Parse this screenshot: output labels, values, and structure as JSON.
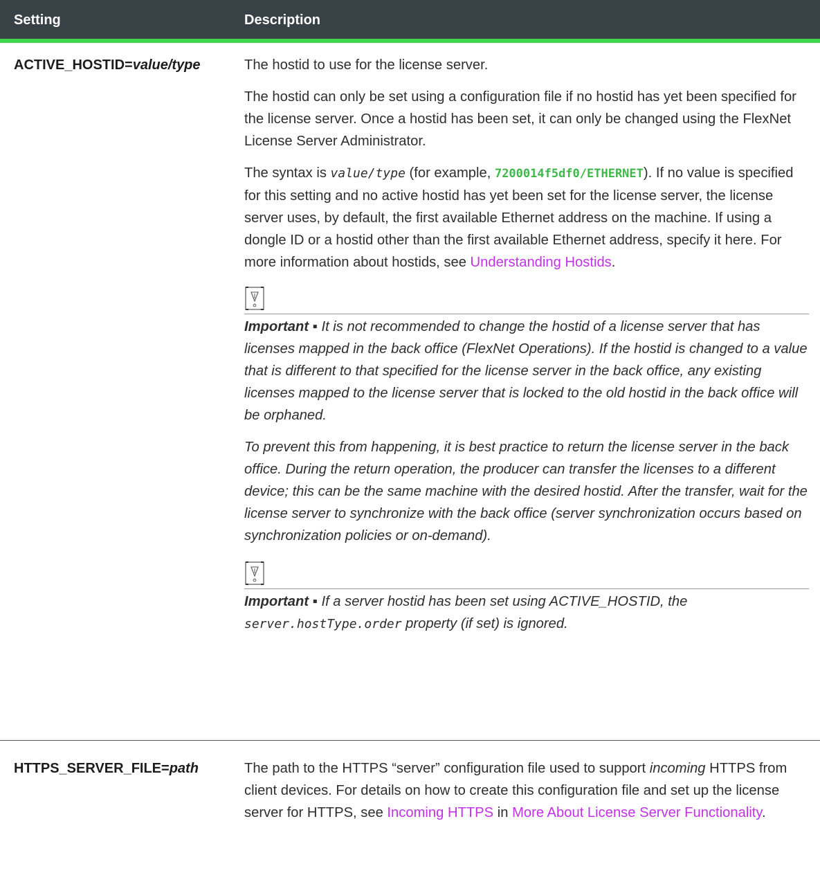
{
  "header": {
    "col_setting": "Setting",
    "col_description": "Description"
  },
  "row1": {
    "setting_name": "ACTIVE_HOSTID=",
    "setting_value": "value/type",
    "p1": "The hostid to use for the license server.",
    "p2": "The hostid can only be set using a configuration file if no hostid has yet been specified for the license server. Once a hostid has been set, it can only be changed using the FlexNet License Server Administrator.",
    "p3_a": "The syntax is ",
    "p3_code": "value/type",
    "p3_b": " (for example, ",
    "p3_example": "7200014f5df0/ETHERNET",
    "p3_c": "). If no value is specified for this setting and no active hostid has yet been set for the license server, the license server uses, by default, the first available Ethernet address on the machine. If using a dongle ID or a hostid other than the first available Ethernet address, specify it here. For more information about hostids, see ",
    "p3_link": "Understanding Hostids",
    "p3_d": ".",
    "note1_label": "Important ▪",
    "note1_text": " It is not recommended to change the hostid of a license server that has licenses mapped in the back office (FlexNet Operations). If the hostid is changed to a value that is different to that specified for the license server in the back office, any existing licenses mapped to the license server that is locked to the old hostid in the back office will be orphaned.",
    "note1_p2": "To prevent this from happening, it is best practice to return the license server in the back office. During the return operation, the producer can transfer the licenses to a different device; this can be the same machine with the desired hostid. After the transfer, wait for the license server to synchronize with the back office (server synchronization occurs based on synchronization policies or on-demand).",
    "note2_label": "Important ▪",
    "note2_a": " If a server hostid has been set using ACTIVE_HOSTID, the ",
    "note2_code": "server.hostType.order",
    "note2_b": " property (if set) is ignored."
  },
  "row2": {
    "setting_name": "HTTPS_SERVER_FILE=",
    "setting_value": "path",
    "p_a": "The path to the HTTPS “server” configuration file used to support ",
    "p_em": "incoming",
    "p_b": " HTTPS from client devices. For details on how to create this configuration file and set up the license server for HTTPS, see ",
    "link1": "Incoming HTTPS",
    "p_c": " in ",
    "link2": "More About License Server Functionality",
    "p_d": "."
  },
  "icons": {
    "note_icon": "important-note-icon"
  },
  "colors": {
    "header_bg": "#384146",
    "accent": "#3fd54d",
    "link": "#c231e8",
    "example_code": "#3fb84a"
  }
}
